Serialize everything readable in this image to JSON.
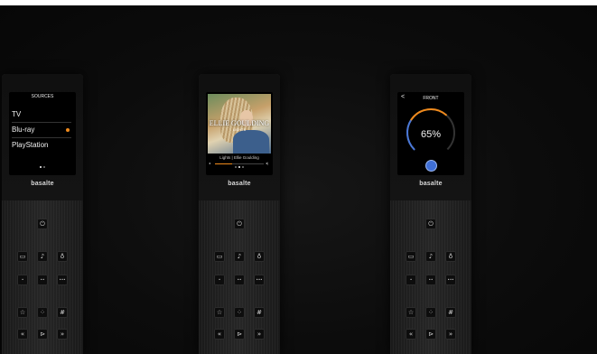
{
  "remotes": [
    {
      "brand": "basalte",
      "screen": {
        "title": "SOURCES",
        "items": [
          "TV",
          "Blu-ray",
          "PlayStation"
        ],
        "selected_item": "Blu-ray",
        "accent_color": "#f08a1c",
        "page": 1,
        "pages": 2
      }
    },
    {
      "brand": "basalte",
      "screen": {
        "artist": "ELLIE GOULDING",
        "album": "LIGHTS",
        "track": "Lights | Ellie Goulding",
        "progress": 0.35,
        "page": 1,
        "pages": 3
      }
    },
    {
      "brand": "basalte",
      "screen": {
        "back_icon": "<",
        "title": "FRONT",
        "value": "65%",
        "level": 0.65,
        "arc_colors": [
          "#4a78d8",
          "#f08a1c"
        ]
      }
    }
  ],
  "buttons": {
    "power": "⏻",
    "screen_icon": "▭",
    "music_icon": "♪",
    "light_icon": "♁",
    "row2": [
      "•",
      "••",
      "•••"
    ],
    "favorite": "☆",
    "grid": "⁘",
    "hash": "#",
    "prev": "«",
    "play": "⊳",
    "next": "»"
  }
}
